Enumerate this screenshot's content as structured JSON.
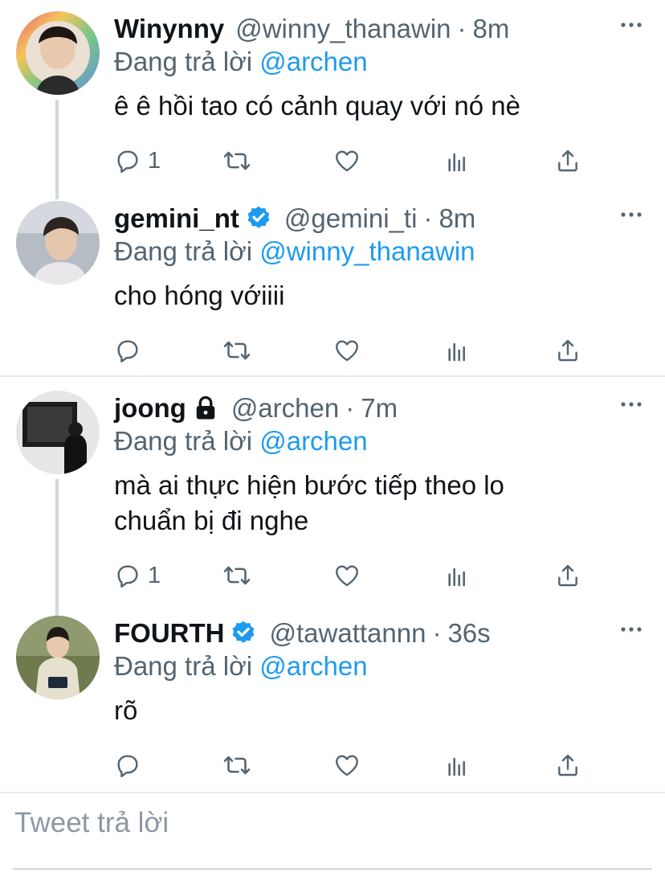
{
  "tweets": [
    {
      "name": "Winynny",
      "handle": "@winny_thanawin",
      "dot": "·",
      "time": "8m",
      "replying_prefix": "Đang trả lời",
      "replying_to": "@archen",
      "text": "ê ê hồi tao có cảnh quay với nó nè",
      "reply_count": "1",
      "verified": false,
      "protected": false
    },
    {
      "name": "gemini_nt",
      "handle": "@gemini_ti",
      "dot": "·",
      "time": "8m",
      "replying_prefix": "Đang trả lời",
      "replying_to": "@winny_thanawin",
      "text": "cho hóng vớiiii",
      "reply_count": "",
      "verified": true,
      "protected": false
    },
    {
      "name": "joong",
      "handle": "@archen",
      "dot": "·",
      "time": "7m",
      "replying_prefix": "Đang trả lời",
      "replying_to": "@archen",
      "text_line1": "mà ai thực hiện bước tiếp theo lo",
      "text_line2": "chuẩn bị đi nghe",
      "reply_count": "1",
      "verified": false,
      "protected": true
    },
    {
      "name": "FOURTH",
      "handle": "@tawattannn",
      "dot": "·",
      "time": "36s",
      "replying_prefix": "Đang trả lời",
      "replying_to": "@archen",
      "text": "rõ",
      "reply_count": "",
      "verified": true,
      "protected": false
    }
  ],
  "compose": {
    "placeholder": "Tweet trả lời"
  },
  "colors": {
    "accent": "#1d9bf0",
    "secondary_text": "#536471",
    "primary_text": "#0f1419",
    "icon": "#536471",
    "divider": "#e7ebee"
  },
  "icons": {
    "reply": "speech-bubble-icon",
    "retweet": "retweet-icon",
    "like": "heart-icon",
    "analytics": "bar-chart-icon",
    "share": "share-icon",
    "more": "more-dots-icon",
    "verified": "verified-badge-icon",
    "protected": "lock-icon"
  }
}
